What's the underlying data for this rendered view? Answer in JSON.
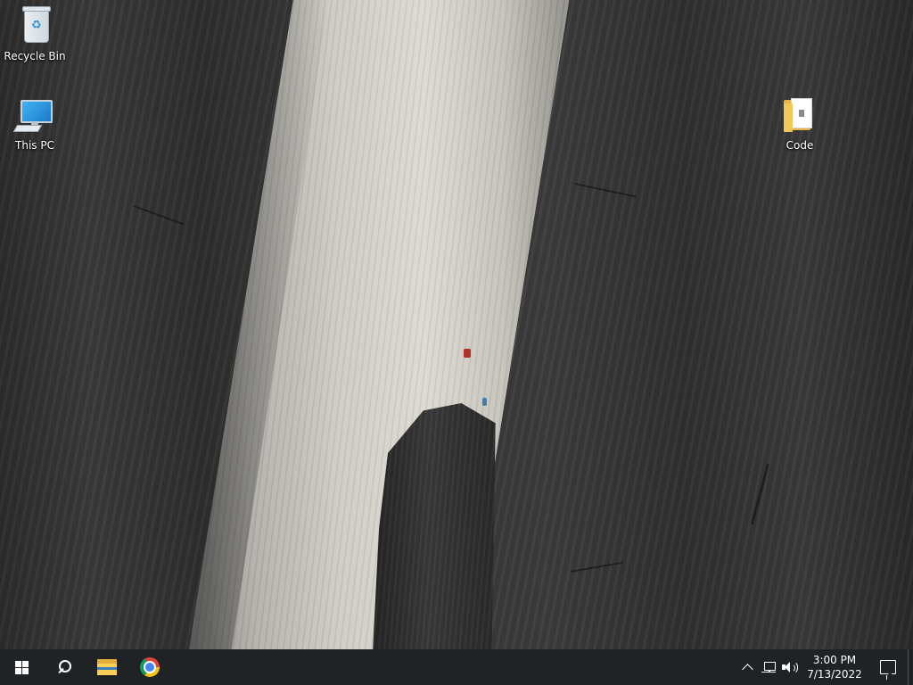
{
  "desktop": {
    "wallpaper": "rock-cliff-climbers",
    "icons": [
      {
        "label": "Recycle Bin",
        "icon": "recycle-bin-icon"
      },
      {
        "label": "This PC",
        "icon": "this-pc-icon"
      },
      {
        "label": "Code",
        "icon": "folder-icon"
      }
    ]
  },
  "taskbar": {
    "start": {
      "icon": "windows-logo-icon"
    },
    "search": {
      "icon": "search-icon"
    },
    "pinned": [
      {
        "name": "File Explorer",
        "icon": "file-explorer-icon"
      },
      {
        "name": "Google Chrome",
        "icon": "chrome-icon"
      }
    ],
    "tray": {
      "icons": [
        "chevron-up-icon",
        "network-icon",
        "volume-icon"
      ],
      "time": "3:00 PM",
      "date": "7/13/2022",
      "notification_icon": "action-center-icon"
    },
    "background_color": "#1f2326"
  }
}
